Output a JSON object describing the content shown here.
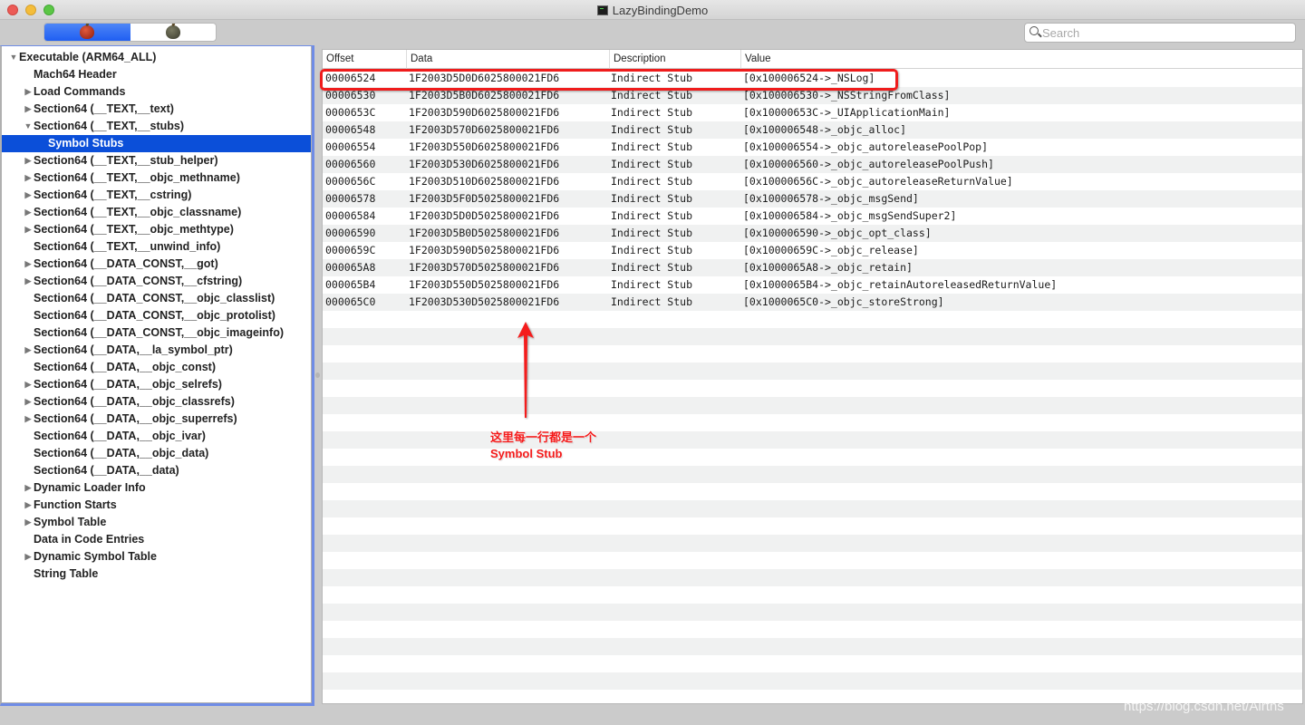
{
  "window": {
    "title": "LazyBindingDemo",
    "title_icon": "terminal-icon"
  },
  "toolbar": {
    "segments": [
      {
        "icon": "red-apple-icon",
        "active": true
      },
      {
        "icon": "gray-apple-icon",
        "active": false
      }
    ],
    "search": {
      "placeholder": "Search",
      "value": ""
    }
  },
  "sidebar": {
    "items": [
      {
        "label": "Executable  (ARM64_ALL)",
        "level": 0,
        "disclosure": "expanded",
        "selected": false
      },
      {
        "label": "Mach64 Header",
        "level": 1,
        "disclosure": "none",
        "selected": false
      },
      {
        "label": "Load Commands",
        "level": 1,
        "disclosure": "collapsed",
        "selected": false
      },
      {
        "label": "Section64 (__TEXT,__text)",
        "level": 1,
        "disclosure": "collapsed",
        "selected": false
      },
      {
        "label": "Section64 (__TEXT,__stubs)",
        "level": 1,
        "disclosure": "expanded",
        "selected": false
      },
      {
        "label": "Symbol Stubs",
        "level": 2,
        "disclosure": "none",
        "selected": true
      },
      {
        "label": "Section64 (__TEXT,__stub_helper)",
        "level": 1,
        "disclosure": "collapsed",
        "selected": false
      },
      {
        "label": "Section64 (__TEXT,__objc_methname)",
        "level": 1,
        "disclosure": "collapsed",
        "selected": false
      },
      {
        "label": "Section64 (__TEXT,__cstring)",
        "level": 1,
        "disclosure": "collapsed",
        "selected": false
      },
      {
        "label": "Section64 (__TEXT,__objc_classname)",
        "level": 1,
        "disclosure": "collapsed",
        "selected": false
      },
      {
        "label": "Section64 (__TEXT,__objc_methtype)",
        "level": 1,
        "disclosure": "collapsed",
        "selected": false
      },
      {
        "label": "Section64 (__TEXT,__unwind_info)",
        "level": 1,
        "disclosure": "none",
        "selected": false
      },
      {
        "label": "Section64 (__DATA_CONST,__got)",
        "level": 1,
        "disclosure": "collapsed",
        "selected": false
      },
      {
        "label": "Section64 (__DATA_CONST,__cfstring)",
        "level": 1,
        "disclosure": "collapsed",
        "selected": false
      },
      {
        "label": "Section64 (__DATA_CONST,__objc_classlist)",
        "level": 1,
        "disclosure": "none",
        "selected": false
      },
      {
        "label": "Section64 (__DATA_CONST,__objc_protolist)",
        "level": 1,
        "disclosure": "none",
        "selected": false
      },
      {
        "label": "Section64 (__DATA_CONST,__objc_imageinfo)",
        "level": 1,
        "disclosure": "none",
        "selected": false
      },
      {
        "label": "Section64 (__DATA,__la_symbol_ptr)",
        "level": 1,
        "disclosure": "collapsed",
        "selected": false
      },
      {
        "label": "Section64 (__DATA,__objc_const)",
        "level": 1,
        "disclosure": "none",
        "selected": false
      },
      {
        "label": "Section64 (__DATA,__objc_selrefs)",
        "level": 1,
        "disclosure": "collapsed",
        "selected": false
      },
      {
        "label": "Section64 (__DATA,__objc_classrefs)",
        "level": 1,
        "disclosure": "collapsed",
        "selected": false
      },
      {
        "label": "Section64 (__DATA,__objc_superrefs)",
        "level": 1,
        "disclosure": "collapsed",
        "selected": false
      },
      {
        "label": "Section64 (__DATA,__objc_ivar)",
        "level": 1,
        "disclosure": "none",
        "selected": false
      },
      {
        "label": "Section64 (__DATA,__objc_data)",
        "level": 1,
        "disclosure": "none",
        "selected": false
      },
      {
        "label": "Section64 (__DATA,__data)",
        "level": 1,
        "disclosure": "none",
        "selected": false
      },
      {
        "label": "Dynamic Loader Info",
        "level": 1,
        "disclosure": "collapsed",
        "selected": false
      },
      {
        "label": "Function Starts",
        "level": 1,
        "disclosure": "collapsed",
        "selected": false
      },
      {
        "label": "Symbol Table",
        "level": 1,
        "disclosure": "collapsed",
        "selected": false
      },
      {
        "label": "Data in Code Entries",
        "level": 1,
        "disclosure": "none",
        "selected": false
      },
      {
        "label": "Dynamic Symbol Table",
        "level": 1,
        "disclosure": "collapsed",
        "selected": false
      },
      {
        "label": "String Table",
        "level": 1,
        "disclosure": "none",
        "selected": false
      }
    ]
  },
  "table": {
    "columns": [
      "Offset",
      "Data",
      "Description",
      "Value"
    ],
    "rows": [
      [
        "00006524",
        "1F2003D5D0D6025800021FD6",
        "Indirect Stub",
        "[0x100006524->_NSLog]"
      ],
      [
        "00006530",
        "1F2003D5B0D6025800021FD6",
        "Indirect Stub",
        "[0x100006530->_NSStringFromClass]"
      ],
      [
        "0000653C",
        "1F2003D590D6025800021FD6",
        "Indirect Stub",
        "[0x10000653C->_UIApplicationMain]"
      ],
      [
        "00006548",
        "1F2003D570D6025800021FD6",
        "Indirect Stub",
        "[0x100006548->_objc_alloc]"
      ],
      [
        "00006554",
        "1F2003D550D6025800021FD6",
        "Indirect Stub",
        "[0x100006554->_objc_autoreleasePoolPop]"
      ],
      [
        "00006560",
        "1F2003D530D6025800021FD6",
        "Indirect Stub",
        "[0x100006560->_objc_autoreleasePoolPush]"
      ],
      [
        "0000656C",
        "1F2003D510D6025800021FD6",
        "Indirect Stub",
        "[0x10000656C->_objc_autoreleaseReturnValue]"
      ],
      [
        "00006578",
        "1F2003D5F0D5025800021FD6",
        "Indirect Stub",
        "[0x100006578->_objc_msgSend]"
      ],
      [
        "00006584",
        "1F2003D5D0D5025800021FD6",
        "Indirect Stub",
        "[0x100006584->_objc_msgSendSuper2]"
      ],
      [
        "00006590",
        "1F2003D5B0D5025800021FD6",
        "Indirect Stub",
        "[0x100006590->_objc_opt_class]"
      ],
      [
        "0000659C",
        "1F2003D590D5025800021FD6",
        "Indirect Stub",
        "[0x10000659C->_objc_release]"
      ],
      [
        "000065A8",
        "1F2003D570D5025800021FD6",
        "Indirect Stub",
        "[0x1000065A8->_objc_retain]"
      ],
      [
        "000065B4",
        "1F2003D550D5025800021FD6",
        "Indirect Stub",
        "[0x1000065B4->_objc_retainAutoreleasedReturnValue]"
      ],
      [
        "000065C0",
        "1F2003D530D5025800021FD6",
        "Indirect Stub",
        "[0x1000065C0->_objc_storeStrong]"
      ]
    ]
  },
  "annotation": {
    "line1": "这里每一行都是一个",
    "line2": "Symbol Stub",
    "color": "#f41a1a"
  },
  "watermark": "https://blog.csdn.net/Airths",
  "colors": {
    "selection": "#0b4fd9",
    "focus_ring": "#6f8ce6",
    "row_stripe": "#f0f1f1",
    "highlight_box": "#ef1c1c"
  }
}
